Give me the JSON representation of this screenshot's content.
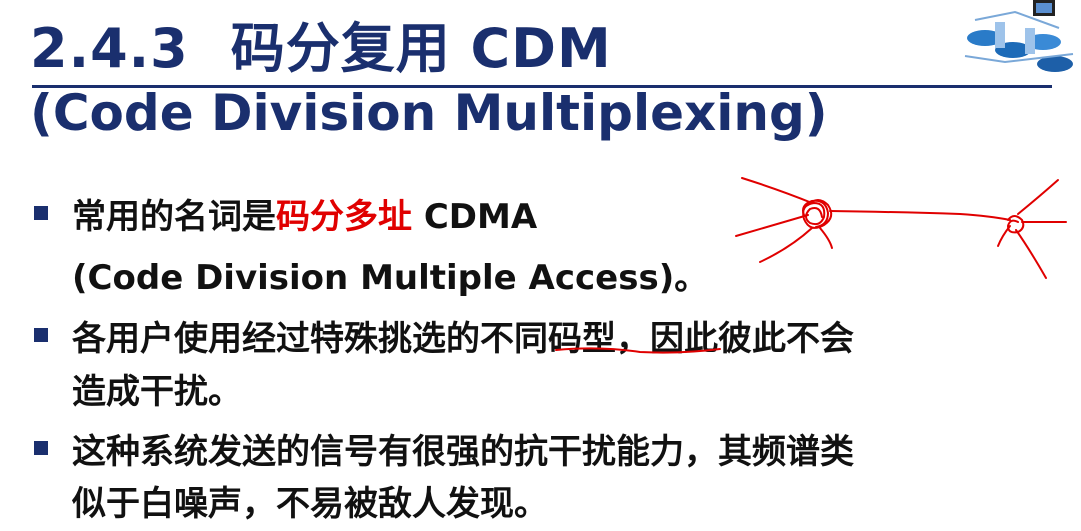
{
  "slide": {
    "title_number": "2.4.3",
    "title_text": "码分复用 CDM",
    "subtitle": "(Code Division Multiplexing)",
    "bullets": [
      {
        "line1_pre": "常用的名词是",
        "line1_highlight": "码分多址",
        "line1_post": " CDMA",
        "line2": "(Code Division Multiple Access)。"
      },
      {
        "line1": "各用户使用经过特殊挑选的不同码型，因此彼此不会",
        "line2": "造成干扰。"
      },
      {
        "line1": "这种系统发送的信号有很强的抗干扰能力，其频谱类",
        "line2": "似于白噪声，不易被敌人发现。"
      }
    ]
  },
  "colors": {
    "title": "#1a2f6e",
    "highlight": "#e00000",
    "annotation": "#e00000"
  },
  "icons": [
    "network-logo-icon",
    "bullet-square-icon"
  ]
}
